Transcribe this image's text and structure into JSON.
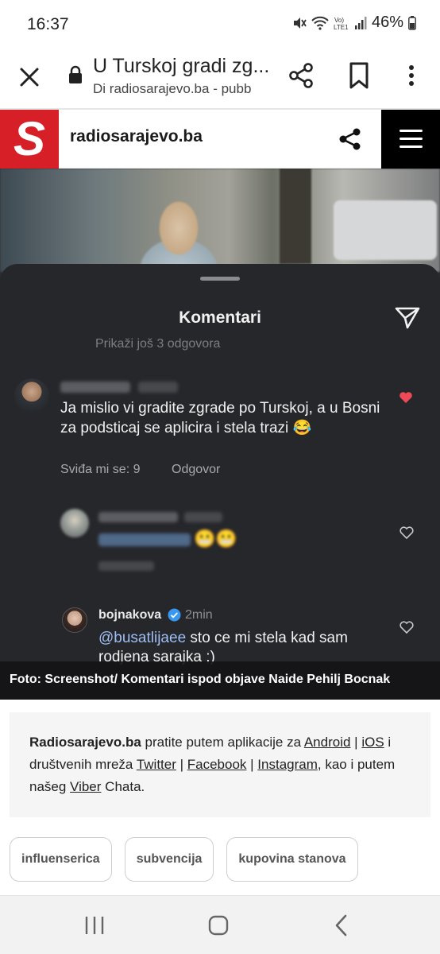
{
  "status_bar": {
    "time": "16:37",
    "battery": "46%"
  },
  "browser": {
    "title": "U Turskoj gradi zg...",
    "subtitle": "Di radiosarajevo.ba - pubb"
  },
  "site": {
    "logo_letter": "S",
    "name": "radiosarajevo.ba"
  },
  "comments_sheet": {
    "title": "Komentari",
    "more_replies": "Prikaži još 3 odgovora",
    "comment1": {
      "text": "Ja mislio vi gradite zgrade po Turskoj, a u Bosni za podsticaj se aplicira i stela trazi 😂",
      "likes": "Sviđa mi se: 9",
      "reply": "Odgovor"
    },
    "comment2": {
      "emoji": "😬😬"
    },
    "comment3": {
      "username": "bojnakova",
      "time": "2min",
      "mention": "@busatlijaee",
      "text": " sto ce mi stela kad sam rodjena sarajka ;)"
    }
  },
  "caption": "Foto: Screenshot/ Komentari ispod objave Naide Pehilj Bocnak",
  "info": {
    "brand": "Radiosarajevo.ba",
    "t1": " pratite putem aplikacije za ",
    "android": "Android",
    "sep1": " | ",
    "ios": "iOS",
    "t2": " i društvenih mreža ",
    "twitter": "Twitter",
    "sep2": " | ",
    "facebook": "Facebook",
    "sep3": " | ",
    "instagram": "Instagram",
    "t3": ", kao i putem našeg ",
    "viber": "Viber",
    "t4": " Chata."
  },
  "tags": [
    "influenserica",
    "subvencija",
    "kupovina stanova"
  ],
  "colors": {
    "brand_red": "#d61f26",
    "sheet_bg": "#26272b",
    "like_red": "#ed4956",
    "verified_blue": "#3897f0"
  }
}
